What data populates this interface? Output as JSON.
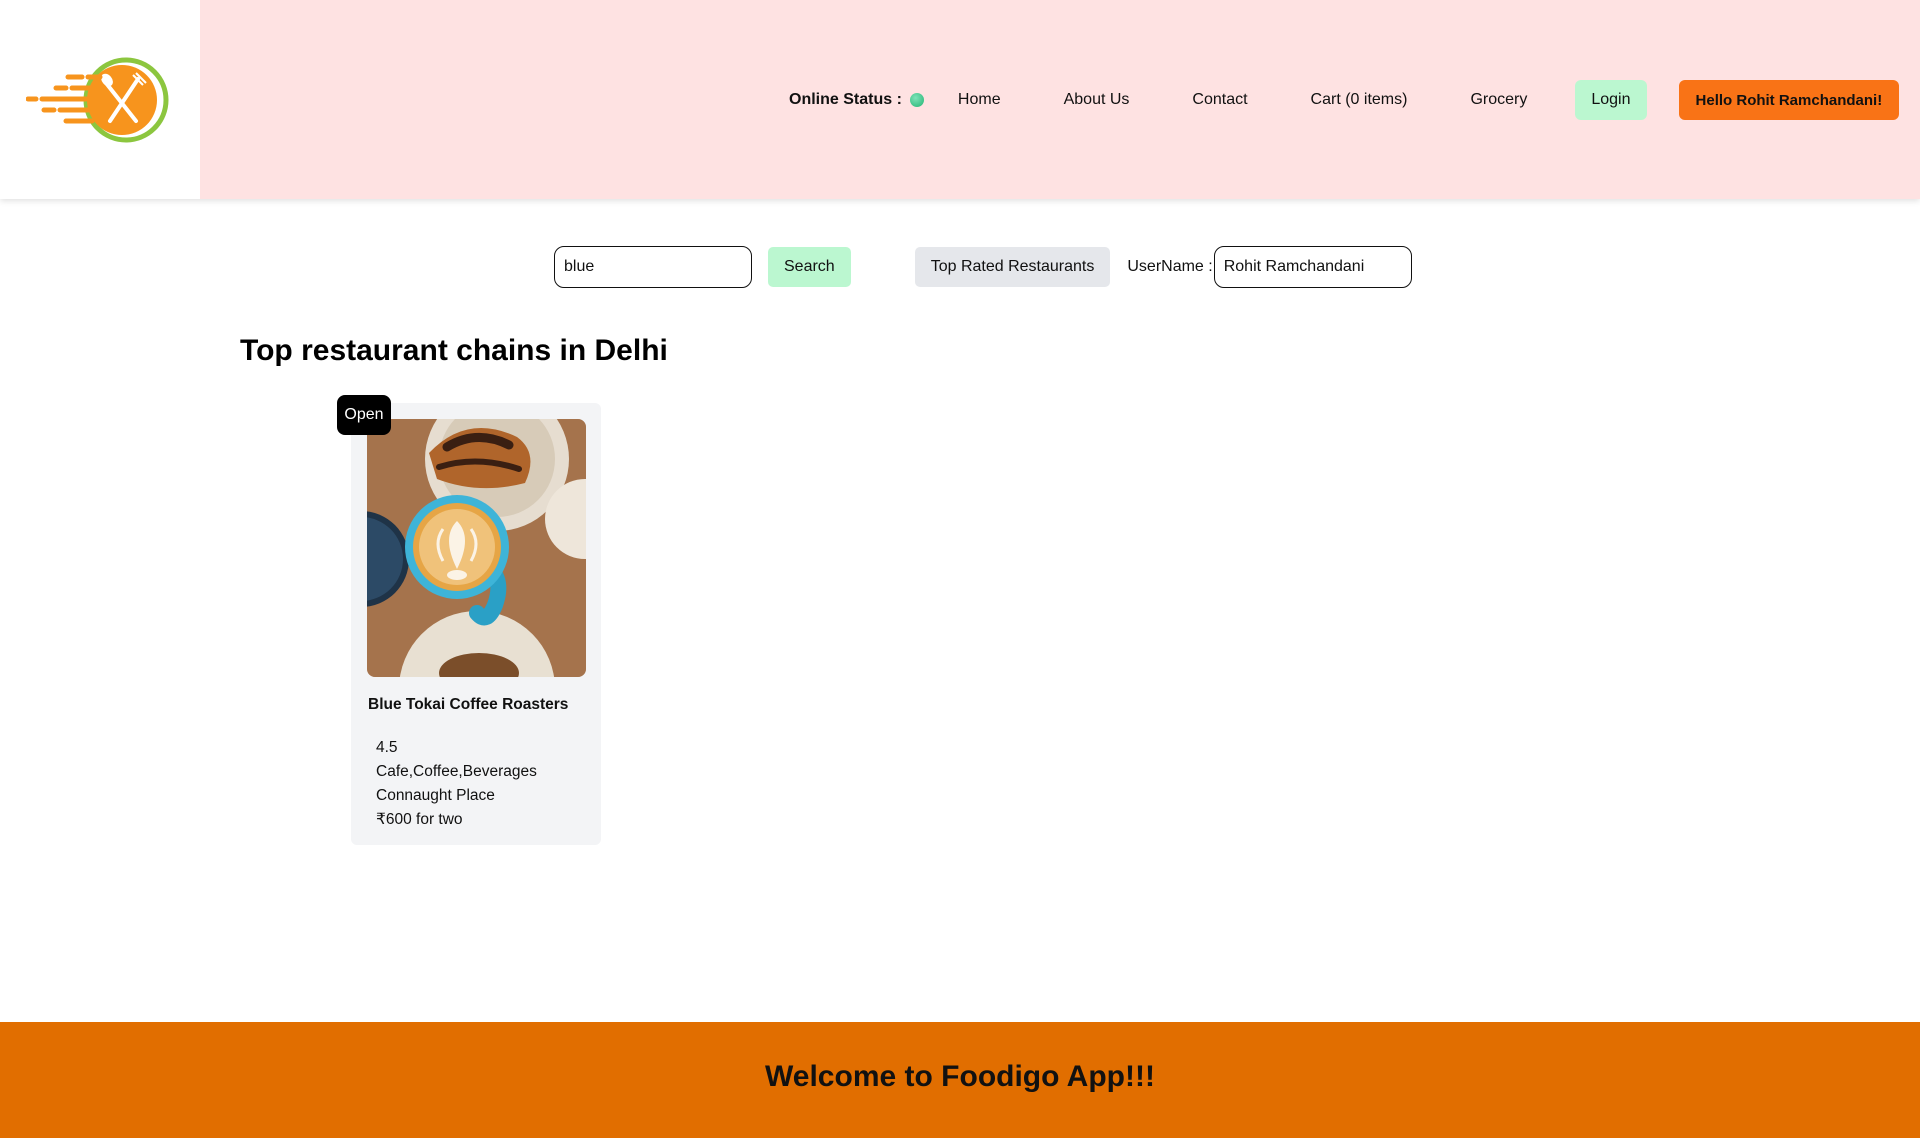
{
  "header": {
    "online_status_label": "Online Status :",
    "online_status_color": "#22b573",
    "nav": [
      {
        "label": "Home"
      },
      {
        "label": "About Us"
      },
      {
        "label": "Contact"
      },
      {
        "label": "Cart (0 items)"
      },
      {
        "label": "Grocery"
      }
    ],
    "login_label": "Login",
    "greeting": "Hello Rohit Ramchandani!"
  },
  "search": {
    "value": "blue",
    "button_label": "Search",
    "top_rated_label": "Top Rated Restaurants",
    "username_label": "UserName :",
    "username_value": "Rohit Ramchandani"
  },
  "main": {
    "title": "Top restaurant chains in Delhi",
    "restaurants": [
      {
        "badge": "Open",
        "name": "Blue Tokai Coffee Roasters",
        "rating": "4.5",
        "cuisines": "Cafe,Coffee,Beverages",
        "area": "Connaught Place",
        "cost": "₹600 for two"
      }
    ]
  },
  "footer": {
    "text": "Welcome to Foodigo App!!!"
  },
  "colors": {
    "header_bg": "#fee2e2",
    "accent_orange": "#f97316",
    "footer_bg": "#e16e00",
    "green_button": "#bbf7d0"
  }
}
